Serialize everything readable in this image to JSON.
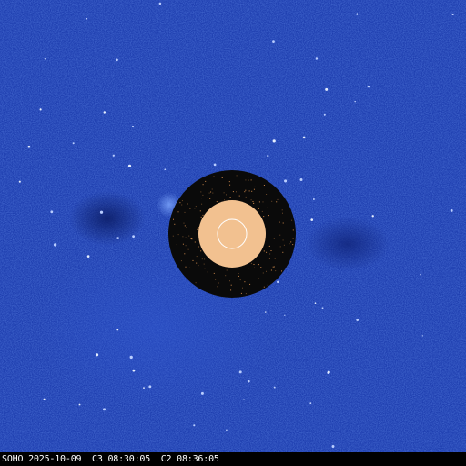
{
  "caption": {
    "observatory": "SOHO",
    "date": "2025-10-09",
    "c3_time": "C3 08:30:05",
    "c2_time": "C2 08:36:05"
  },
  "colors": {
    "background_blue": "#1f3fb0",
    "occulter_ring": "#0a0a0a",
    "sun_disk": "#f2c190",
    "limb_circle": "#ffffff",
    "caption_text": "#ffffff"
  }
}
